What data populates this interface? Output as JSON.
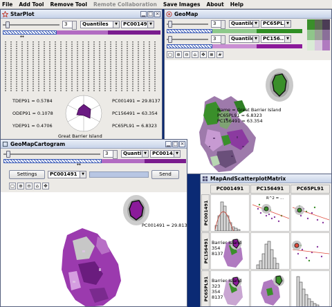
{
  "menubar": [
    "File",
    "Add Tool",
    "Remove Tool",
    "Remote Collaboration",
    "Save Images",
    "About",
    "Help"
  ],
  "menubar_disabled": [
    false,
    false,
    false,
    true,
    false,
    false,
    false
  ],
  "starplot": {
    "title": "StarPlot",
    "classes": "3",
    "method": "Quantiles",
    "variable": "PC001491",
    "readouts": {
      "tdep": "TDEP91 = 0.5784",
      "odep": "ODEP91 = 0.1078",
      "ydep": "YDEP91 = 0.4706",
      "pc001": "PC001491 = 29.8137",
      "pc156": "PC156491 = 63.354",
      "pc65": "PC65PL91 = 6.8323"
    },
    "place": "Great Barrier Island"
  },
  "geomap": {
    "title": "GeoMap",
    "classes": "3",
    "method": "Quantiles",
    "variable_x": "PC65PL...",
    "variable_y": "PC156...",
    "tooltip": [
      "Name = Great Barrier Island",
      "PC65PL91 = 6.8323",
      "PC156491 = 63.354"
    ],
    "colors": [
      "#3a8f2a",
      "#a45fb0",
      "#6e8f52",
      "#8b3aa0",
      "#e3d0e8",
      "#c7e0bf"
    ]
  },
  "cartogram": {
    "title": "GeoMapCartogram",
    "classes": "3",
    "method": "Quantiles",
    "variable": "PC0014...",
    "settings_label": "Settings",
    "combo_value": "PC001491",
    "send_label": "Send",
    "readout": "PC001491 = 29.8137"
  },
  "matrix": {
    "title": "MapAndScatterplotMatrix",
    "columns": [
      "PC001491",
      "PC156491",
      "PC65PL91"
    ],
    "rows": [
      "PC001491",
      "PC156491",
      "PC65PL91"
    ],
    "labels": {
      "r0": "R^2 = ...",
      "mid_name": "Barrier Island",
      "mid_v1": "354",
      "mid_v2": "8137",
      "bot_name": "Barrier Island",
      "bot_v1": "323",
      "bot_v2": "354",
      "bot_v3": "8137"
    }
  }
}
